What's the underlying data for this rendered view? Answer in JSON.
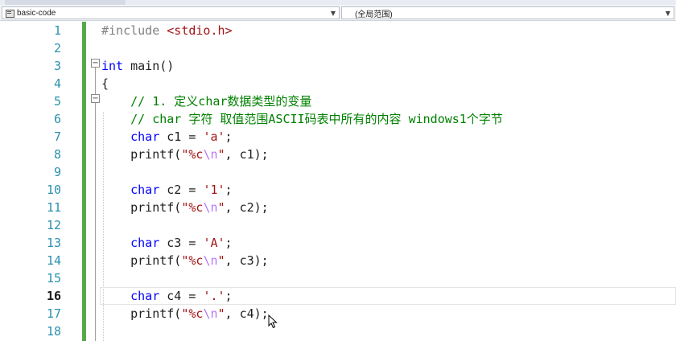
{
  "navbar": {
    "project_combo": "basic-code",
    "scope_combo": "(全局范围)"
  },
  "editor": {
    "lines": [
      {
        "num": "1",
        "tokens": [
          {
            "t": "pp",
            "v": "#include "
          },
          {
            "t": "str",
            "v": "<stdio.h>"
          }
        ]
      },
      {
        "num": "2",
        "tokens": []
      },
      {
        "num": "3",
        "tokens": [
          {
            "t": "kw",
            "v": "int"
          },
          {
            "t": "id",
            "v": " main()"
          }
        ]
      },
      {
        "num": "4",
        "tokens": [
          {
            "t": "id",
            "v": "{"
          }
        ]
      },
      {
        "num": "5",
        "tokens": [
          {
            "t": "cm",
            "v": "    // 1. 定义char数据类型的变量"
          }
        ]
      },
      {
        "num": "6",
        "tokens": [
          {
            "t": "cm",
            "v": "    // char 字符 取值范围ASCII码表中所有的内容 windows1个字节"
          }
        ]
      },
      {
        "num": "7",
        "tokens": [
          {
            "t": "id",
            "v": "    "
          },
          {
            "t": "kw",
            "v": "char"
          },
          {
            "t": "id",
            "v": " c1 = "
          },
          {
            "t": "str",
            "v": "'a'"
          },
          {
            "t": "id",
            "v": ";"
          }
        ]
      },
      {
        "num": "8",
        "tokens": [
          {
            "t": "id",
            "v": "    printf("
          },
          {
            "t": "str",
            "v": "\"%c"
          },
          {
            "t": "esc",
            "v": "\\n"
          },
          {
            "t": "str",
            "v": "\""
          },
          {
            "t": "id",
            "v": ", c1);"
          }
        ]
      },
      {
        "num": "9",
        "tokens": []
      },
      {
        "num": "10",
        "tokens": [
          {
            "t": "id",
            "v": "    "
          },
          {
            "t": "kw",
            "v": "char"
          },
          {
            "t": "id",
            "v": " c2 = "
          },
          {
            "t": "str",
            "v": "'1'"
          },
          {
            "t": "id",
            "v": ";"
          }
        ]
      },
      {
        "num": "11",
        "tokens": [
          {
            "t": "id",
            "v": "    printf("
          },
          {
            "t": "str",
            "v": "\"%c"
          },
          {
            "t": "esc",
            "v": "\\n"
          },
          {
            "t": "str",
            "v": "\""
          },
          {
            "t": "id",
            "v": ", c2);"
          }
        ]
      },
      {
        "num": "12",
        "tokens": []
      },
      {
        "num": "13",
        "tokens": [
          {
            "t": "id",
            "v": "    "
          },
          {
            "t": "kw",
            "v": "char"
          },
          {
            "t": "id",
            "v": " c3 = "
          },
          {
            "t": "str",
            "v": "'A'"
          },
          {
            "t": "id",
            "v": ";"
          }
        ]
      },
      {
        "num": "14",
        "tokens": [
          {
            "t": "id",
            "v": "    printf("
          },
          {
            "t": "str",
            "v": "\"%c"
          },
          {
            "t": "esc",
            "v": "\\n"
          },
          {
            "t": "str",
            "v": "\""
          },
          {
            "t": "id",
            "v": ", c3);"
          }
        ]
      },
      {
        "num": "15",
        "tokens": []
      },
      {
        "num": "16",
        "tokens": [
          {
            "t": "id",
            "v": "    "
          },
          {
            "t": "kw",
            "v": "char"
          },
          {
            "t": "id",
            "v": " c4 = "
          },
          {
            "t": "str",
            "v": "'.'"
          },
          {
            "t": "id",
            "v": ";"
          }
        ],
        "current": true
      },
      {
        "num": "17",
        "tokens": [
          {
            "t": "id",
            "v": "    printf("
          },
          {
            "t": "str",
            "v": "\"%c"
          },
          {
            "t": "esc",
            "v": "\\n"
          },
          {
            "t": "str",
            "v": "\""
          },
          {
            "t": "id",
            "v": ", c4);"
          }
        ]
      },
      {
        "num": "18",
        "tokens": []
      }
    ]
  },
  "colors": {
    "keyword": "#0000ff",
    "string": "#a31515",
    "escape": "#b776fb",
    "comment": "#008000",
    "preprocessor": "#808080",
    "line_number": "#2b91af",
    "change_bar": "#58a84b"
  },
  "icons": {
    "project_combo_icon": "class-icon",
    "combo_arrow": "chevron-down-icon",
    "fold_toggle": "collapse-icon",
    "mouse_cursor": "arrow-cursor-icon"
  }
}
